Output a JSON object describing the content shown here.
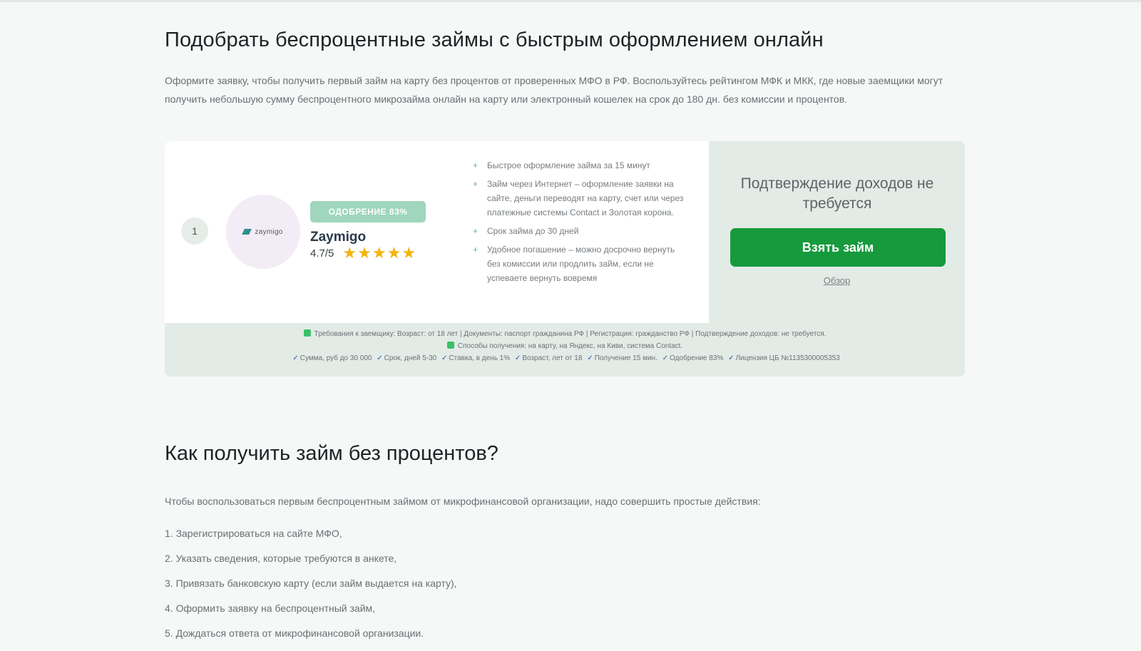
{
  "page": {
    "title": "Подобрать беспроцентные займы с быстрым оформлением онлайн",
    "intro": "Оформите заявку, чтобы получить первый займ на карту без процентов от проверенных МФО в РФ. Воспользуйтесь рейтингом МФК и МКК, где новые заемщики могут получить небольшую сумму беспроцентного микрозайма онлайн на карту или электронный кошелек на срок до 180 дн. без комиссии и процентов."
  },
  "offer": {
    "rank": "1",
    "logo_text": "zaymigo",
    "approval_badge": "ОДОБРЕНИЕ 83%",
    "name": "Zaymigo",
    "rating": "4.7/5",
    "stars": 5,
    "features": [
      "Быстрое оформление займа за 15 минут",
      "Займ через Интернет – оформление заявки на сайте, деньги переводят на карту, счет или через платежные системы Contact и Золотая корона.",
      "Срок займа до 30 дней",
      "Удобное погашение – можно досрочно вернуть без комиссии или продлить займ, если не успеваете вернуть вовремя"
    ],
    "side_note": "Подтверждение доходов не требуется",
    "cta_label": "Взять займ",
    "review_link": "Обзор",
    "requirements": "Требования к заемщику: Возраст: от 18 лет | Документы: паспорт гражданина РФ | Регистрация: гражданство РФ | Подтверждение доходов: не требуется.",
    "methods": "Способы получения: на карту, на Яндекс, на Киви, система Contact.",
    "params": [
      "Сумма, руб до 30 000",
      "Срок, дней 5-30",
      "Ставка, в день 1%",
      "Возраст, лет от 18",
      "Получение 15 мин.",
      "Одобрение 83%",
      "Лицензия ЦБ №1135300005353"
    ]
  },
  "section": {
    "title": "Как получить займ без процентов?",
    "lead": "Чтобы воспользоваться первым беспроцентным займом от микрофинансовой организации, надо совершить простые действия:",
    "steps": [
      "1. Зарегистрироваться на сайте МФО,",
      "2. Указать сведения, которые требуются в анкете,",
      "3. Привязать банковскую карту (если займ выдается на карту),",
      "4. Оформить заявку на беспроцентный займ,",
      "5. Дождаться ответа от микрофинансовой организации."
    ]
  },
  "colors": {
    "cta": "#169a3c",
    "badge": "#9fd6bd",
    "star": "#f4b40b",
    "card_bg": "#e3ebe6"
  }
}
